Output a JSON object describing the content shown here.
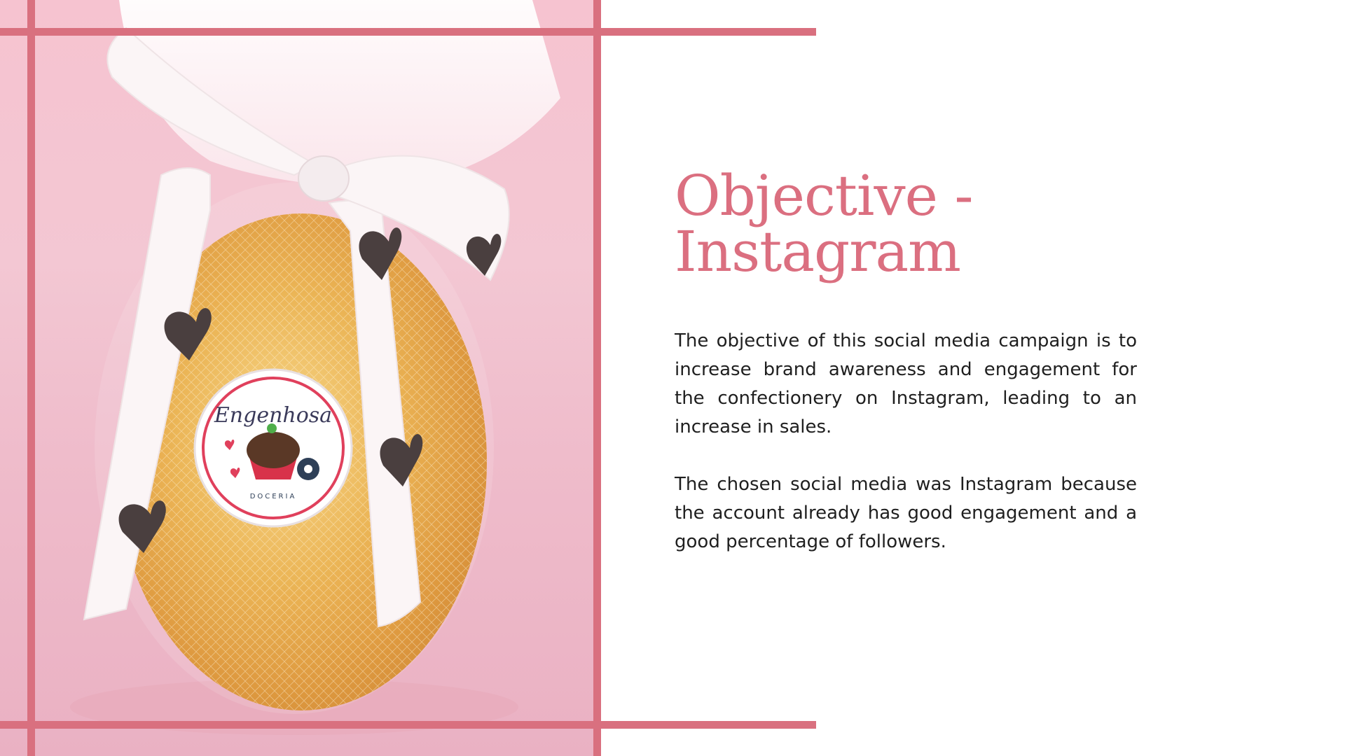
{
  "slide": {
    "title_line1": "Objective -",
    "title_line2": "Instagram",
    "paragraph1": "The objective of this social media campaign is to increase brand awareness and engagement for the confectionery on Instagram, leading to an increase in sales.",
    "paragraph2": "The chosen social media was Instagram because the account already has good engagement and a good percentage of followers."
  },
  "photo": {
    "logo_name": "Engenhosa",
    "logo_subtitle": "DOCERIA",
    "ribbon_text": "Engenhosa",
    "ribbon_handle": "engenhosa"
  },
  "colors": {
    "accent": "#d9707f",
    "title": "#db6f80",
    "body_text": "#1f1f1f",
    "background": "#ffffff",
    "photo_background": "#f3c3cf",
    "egg_gold": "#e8a83a"
  }
}
